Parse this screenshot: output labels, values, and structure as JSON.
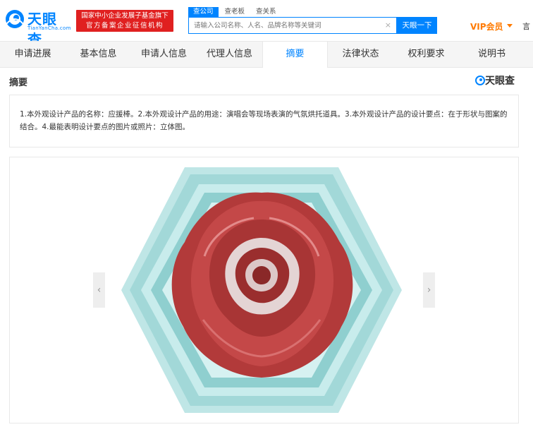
{
  "header": {
    "logo_text": "天眼查",
    "logo_sub": "TianYanCha.com",
    "badge_line1": "国家中小企业发展子基金旗下",
    "badge_line2": "官方备案企业征信机构",
    "search_tabs": [
      "查公司",
      "查老板",
      "查关系"
    ],
    "search_placeholder": "请输入公司名称、人名、品牌名称等关键词",
    "search_clear": "×",
    "search_button": "天眼一下",
    "vip_label": "VIP会员",
    "right_text": "言"
  },
  "nav": {
    "items": [
      "申请进展",
      "基本信息",
      "申请人信息",
      "代理人信息",
      "摘要",
      "法律状态",
      "权利要求",
      "说明书"
    ],
    "active_index": 4
  },
  "section": {
    "title": "摘要",
    "watermark": "天眼查"
  },
  "abstract": {
    "text": "1.本外观设计产品的名称：应援棒。2.本外观设计产品的用途：演唱会等现场表演的气氛烘托道具。3.本外观设计产品的设计要点：在于形状与图案的结合。4.最能表明设计要点的图片或照片：立体图。"
  },
  "carousel": {
    "prev_arrow": "‹",
    "next_arrow": "›"
  },
  "colors": {
    "brand_blue": "#0084ff",
    "badge_red": "#e02020",
    "vip_orange": "#ff7a00",
    "hexagon_teal": "#a9dcdc",
    "rose_red": "#b93a3a"
  }
}
